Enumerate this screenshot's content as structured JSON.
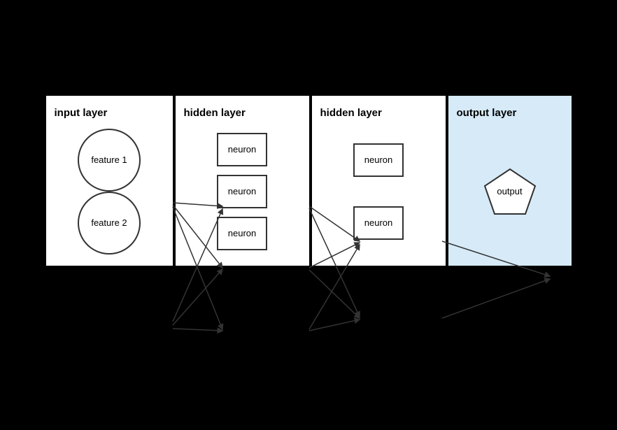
{
  "layers": [
    {
      "id": "input-layer",
      "title": "input layer",
      "type": "input",
      "nodes": [
        {
          "label": "feature 1"
        },
        {
          "label": "feature 2"
        }
      ]
    },
    {
      "id": "hidden-layer-1",
      "title": "hidden layer",
      "type": "hidden1",
      "nodes": [
        {
          "label": "neuron"
        },
        {
          "label": "neuron"
        },
        {
          "label": "neuron"
        }
      ]
    },
    {
      "id": "hidden-layer-2",
      "title": "hidden layer",
      "type": "hidden2",
      "nodes": [
        {
          "label": "neuron"
        },
        {
          "label": "neuron"
        }
      ]
    },
    {
      "id": "output-layer",
      "title": "output layer",
      "type": "output",
      "nodes": [
        {
          "label": "output"
        }
      ]
    }
  ]
}
